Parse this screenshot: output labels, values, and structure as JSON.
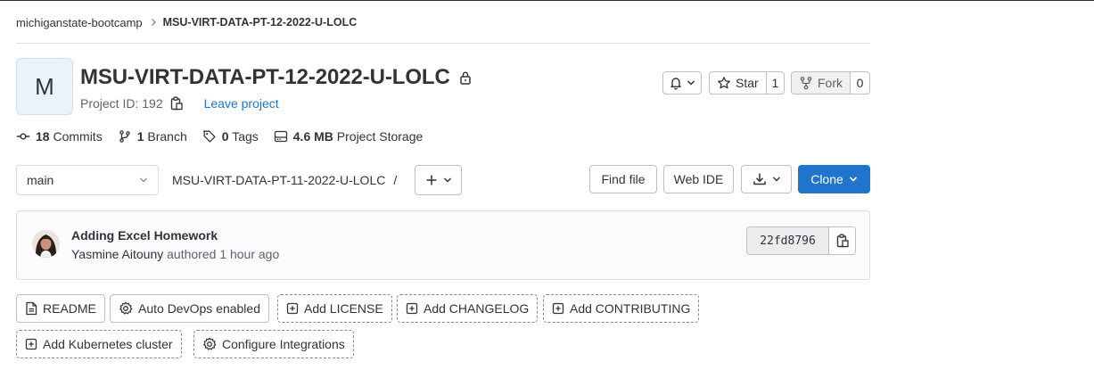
{
  "breadcrumb": {
    "group": "michiganstate-bootcamp",
    "project": "MSU-VIRT-DATA-PT-12-2022-U-LOLC"
  },
  "project": {
    "avatar_letter": "M",
    "name": "MSU-VIRT-DATA-PT-12-2022-U-LOLC",
    "visibility_icon": "lock-icon",
    "id_label": "Project ID: 192",
    "leave_label": "Leave project"
  },
  "actions": {
    "star_label": "Star",
    "star_count": "1",
    "fork_label": "Fork",
    "fork_count": "0"
  },
  "stats": {
    "commits_count": "18",
    "commits_label": "Commits",
    "branches_count": "1",
    "branches_label": "Branch",
    "tags_count": "0",
    "tags_label": "Tags",
    "storage_size": "4.6 MB",
    "storage_label": "Project Storage"
  },
  "tree": {
    "branch": "main",
    "path": "MSU-VIRT-DATA-PT-11-2022-U-LOLC",
    "path_sep": "/",
    "find_file": "Find file",
    "web_ide": "Web IDE",
    "clone": "Clone"
  },
  "commit": {
    "title": "Adding Excel Homework",
    "author": "Yasmine Aitouny",
    "action": "authored",
    "time": "1 hour ago",
    "sha": "22fd8796"
  },
  "quick_actions": {
    "readme": "README",
    "auto_devops": "Auto DevOps enabled",
    "add_license": "Add LICENSE",
    "add_changelog": "Add CHANGELOG",
    "add_contributing": "Add CONTRIBUTING",
    "add_kubernetes": "Add Kubernetes cluster",
    "configure_integrations": "Configure Integrations"
  },
  "colors": {
    "primary": "#1f75cb",
    "text": "#333238",
    "muted": "#626168",
    "border": "#bfbfc3"
  }
}
